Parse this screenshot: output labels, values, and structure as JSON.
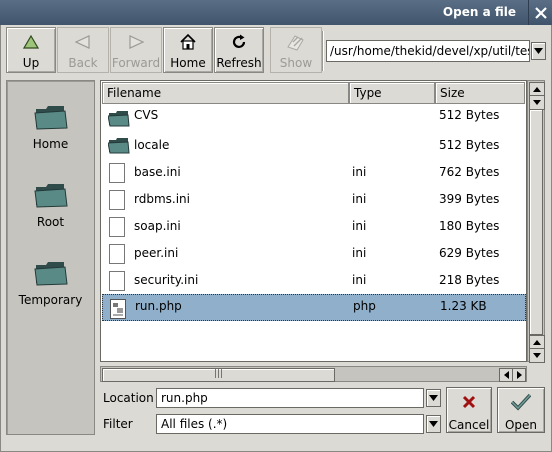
{
  "window": {
    "title": "Open a file",
    "close_icon": "close-icon"
  },
  "toolbar": {
    "up": "Up",
    "back": "Back",
    "forward": "Forward",
    "home": "Home",
    "refresh": "Refresh",
    "show": "Show",
    "path": "/usr/home/thekid/devel/xp/util/tests/"
  },
  "sidebar": {
    "items": [
      {
        "label": "Home",
        "icon": "folder-icon"
      },
      {
        "label": "Root",
        "icon": "folder-icon"
      },
      {
        "label": "Temporary",
        "icon": "folder-icon"
      }
    ]
  },
  "filelist": {
    "columns": [
      "Filename",
      "Type",
      "Size"
    ],
    "rows": [
      {
        "name": "CVS",
        "type": "",
        "size": "512 Bytes",
        "icon": "folder-icon"
      },
      {
        "name": "locale",
        "type": "",
        "size": "512 Bytes",
        "icon": "folder-icon"
      },
      {
        "name": "base.ini",
        "type": "ini",
        "size": "762 Bytes",
        "icon": "file-icon"
      },
      {
        "name": "rdbms.ini",
        "type": "ini",
        "size": "399 Bytes",
        "icon": "file-icon"
      },
      {
        "name": "soap.ini",
        "type": "ini",
        "size": "180 Bytes",
        "icon": "file-icon"
      },
      {
        "name": "peer.ini",
        "type": "ini",
        "size": "629 Bytes",
        "icon": "file-icon"
      },
      {
        "name": "security.ini",
        "type": "ini",
        "size": "218 Bytes",
        "icon": "file-icon"
      },
      {
        "name": "run.php",
        "type": "php",
        "size": "1.23 KB",
        "icon": "php-file-icon",
        "selected": true
      }
    ]
  },
  "form": {
    "location_label": "Location",
    "location_value": "run.php",
    "filter_label": "Filter",
    "filter_value": "All files (.*)",
    "cancel": "Cancel",
    "open": "Open"
  },
  "colors": {
    "titlebar": "#4a5f76",
    "selection": "#8fafca",
    "window_bg": "#dcdad5"
  }
}
